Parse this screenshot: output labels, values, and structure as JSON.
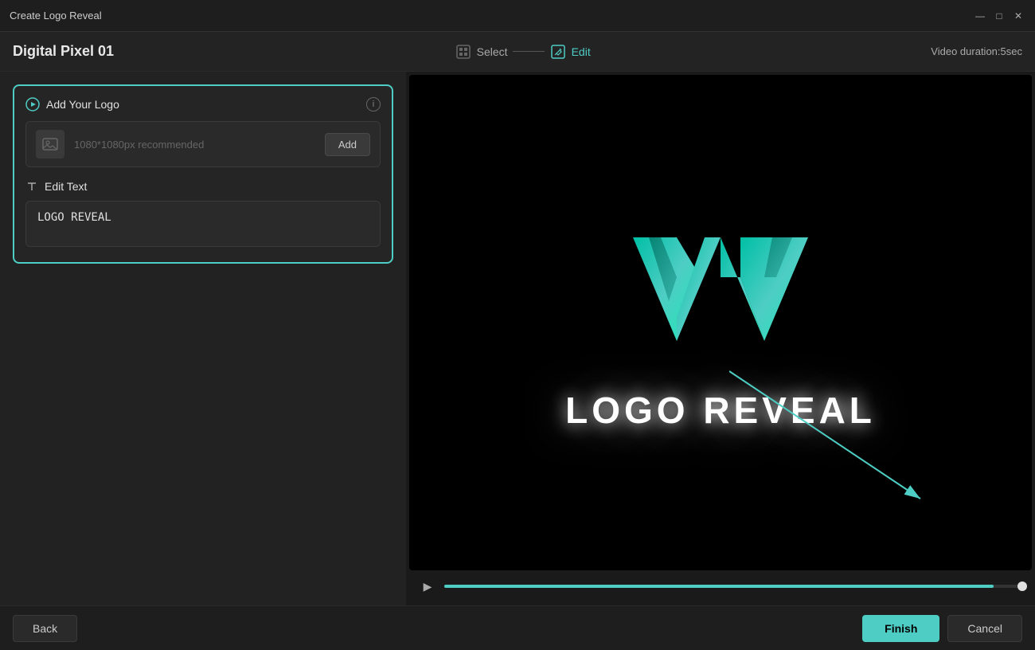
{
  "titleBar": {
    "title": "Create Logo Reveal",
    "minimizeIcon": "—",
    "restoreIcon": "□",
    "closeIcon": "✕"
  },
  "topBar": {
    "projectName": "Digital Pixel 01",
    "steps": [
      {
        "id": "select",
        "label": "Select",
        "active": false
      },
      {
        "id": "edit",
        "label": "Edit",
        "active": true
      }
    ],
    "duration": "Video duration:5sec"
  },
  "leftPanel": {
    "logoSection": {
      "title": "Add Your Logo",
      "placeholder": "1080*1080px recommended",
      "addButton": "Add",
      "infoTooltip": "i"
    },
    "editText": {
      "title": "Edit Text",
      "value": "LOGO REVEAL"
    }
  },
  "preview": {
    "logoText": "LOGO REVEAL"
  },
  "playback": {
    "playIcon": "▶",
    "progressPercent": 95
  },
  "bottomBar": {
    "backButton": "Back",
    "finishButton": "Finish",
    "cancelButton": "Cancel"
  }
}
